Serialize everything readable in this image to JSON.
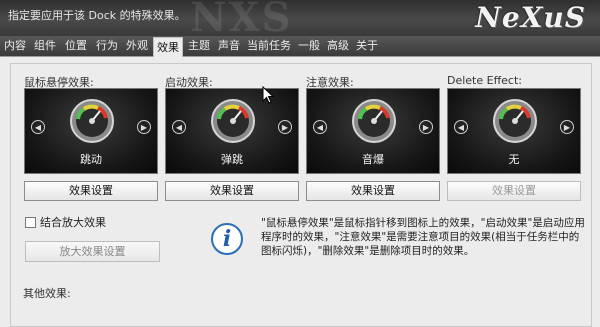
{
  "header": {
    "description": "指定要应用于该 Dock 的特殊效果。",
    "logo": "NeXuS"
  },
  "tabs": [
    {
      "label": "内容"
    },
    {
      "label": "组件"
    },
    {
      "label": "位置"
    },
    {
      "label": "行为"
    },
    {
      "label": "外观"
    },
    {
      "label": "效果",
      "active": true
    },
    {
      "label": "主题"
    },
    {
      "label": "声音"
    },
    {
      "label": "当前任务"
    },
    {
      "label": "一般"
    },
    {
      "label": "高级"
    },
    {
      "label": "关于"
    }
  ],
  "effects": [
    {
      "title": "鼠标悬停效果:",
      "value": "跳动",
      "button": "效果设置"
    },
    {
      "title": "启动效果:",
      "value": "弹跳",
      "button": "效果设置"
    },
    {
      "title": "注意效果:",
      "value": "音爆",
      "button": "效果设置"
    },
    {
      "title": "Delete Effect:",
      "value": "无",
      "button": "效果设置",
      "disabled": true
    }
  ],
  "zoom": {
    "checkbox_label": "结合放大效果",
    "checked": false,
    "button": "放大效果设置"
  },
  "info": {
    "icon": "info-icon",
    "text": "\"鼠标悬停效果\"是鼠标指针移到图标上的效果，\"启动效果\"是启动应用程序时的效果，\"注意效果\"是需要注意项目的效果(相当于任务栏中的图标闪烁)，\"删除效果\"是删除项目时的效果。"
  },
  "other_effects_label": "其他效果:",
  "colors": {
    "accent": "#2a6fb5",
    "header_bg": "#3a3a3a",
    "tab_active_bg": "#ececec"
  }
}
